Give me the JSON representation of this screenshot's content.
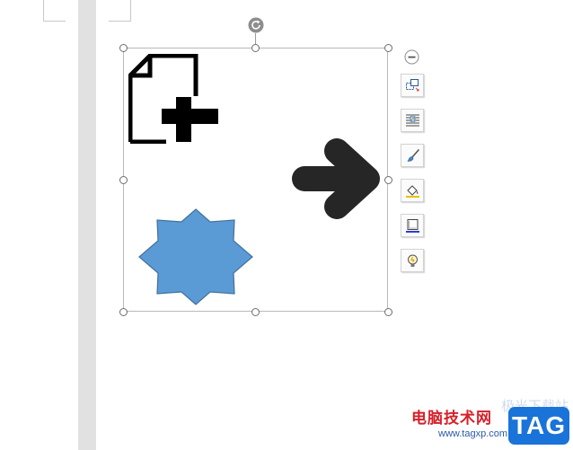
{
  "document": {
    "shapes": [
      {
        "name": "new-page-icon-shape",
        "fill": "#000000"
      },
      {
        "name": "arrow-right-shape",
        "fill": "#262626"
      },
      {
        "name": "star-shape",
        "fill": "#5b9bd5",
        "stroke": "#41719c"
      }
    ]
  },
  "toolbar": {
    "collapse_icon": "minus-circle-icon",
    "buttons": [
      {
        "name": "layout-options-button",
        "icon": "layout-icon"
      },
      {
        "name": "text-wrap-button",
        "icon": "wrap-text-icon"
      },
      {
        "name": "shape-outline-button",
        "icon": "brush-icon"
      },
      {
        "name": "shape-fill-button",
        "icon": "paint-bucket-icon"
      },
      {
        "name": "shape-effects-button",
        "icon": "frame-icon"
      },
      {
        "name": "smart-tips-button",
        "icon": "lightbulb-icon"
      }
    ]
  },
  "watermark": {
    "title": "电脑技术网",
    "url": "www.tagxp.com",
    "badge": "TAG",
    "faint": "极光下载站",
    "brand_color": "#1a73d9",
    "title_color": "#d6202a"
  }
}
